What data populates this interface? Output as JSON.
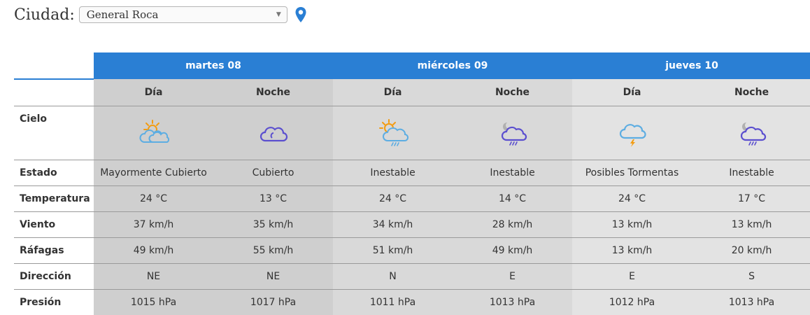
{
  "city": {
    "label": "Ciudad:",
    "selected": "General Roca"
  },
  "days": [
    {
      "title": "martes 08"
    },
    {
      "title": "miércoles 09"
    },
    {
      "title": "jueves 10"
    }
  ],
  "periods": [
    "Día",
    "Noche",
    "Día",
    "Noche",
    "Día",
    "Noche"
  ],
  "row_labels": {
    "sky": "Cielo",
    "state": "Estado",
    "temp": "Temperatura",
    "wind": "Viento",
    "gust": "Ráfagas",
    "dir": "Dirección",
    "press": "Presión"
  },
  "sky_icons": [
    "sun-cloud-icon",
    "cloud-icon",
    "sun-cloud-rain-icon",
    "moon-cloud-rain-icon",
    "storm-icon",
    "moon-cloud-rain-icon"
  ],
  "state": [
    "Mayormente Cubierto",
    "Cubierto",
    "Inestable",
    "Inestable",
    "Posibles Tormentas",
    "Inestable"
  ],
  "temp": [
    "24 °C",
    "13 °C",
    "24 °C",
    "14 °C",
    "24 °C",
    "17 °C"
  ],
  "wind": [
    "37 km/h",
    "35 km/h",
    "34 km/h",
    "28 km/h",
    "13 km/h",
    "13 km/h"
  ],
  "gust": [
    "49 km/h",
    "55 km/h",
    "51 km/h",
    "49 km/h",
    "13 km/h",
    "20 km/h"
  ],
  "dir": [
    "NE",
    "NE",
    "N",
    "E",
    "E",
    "S"
  ],
  "press": [
    "1015 hPa",
    "1017 hPa",
    "1011 hPa",
    "1013 hPa",
    "1012 hPa",
    "1013 hPa"
  ],
  "colors": {
    "header_blue": "#2a7fd4",
    "pin_blue": "#2a7fd4",
    "sun_orange": "#f39c12",
    "cloud_blue": "#5dade2",
    "cloud_purple": "#5b4fcf",
    "moon_gray": "#b0b0b0"
  }
}
